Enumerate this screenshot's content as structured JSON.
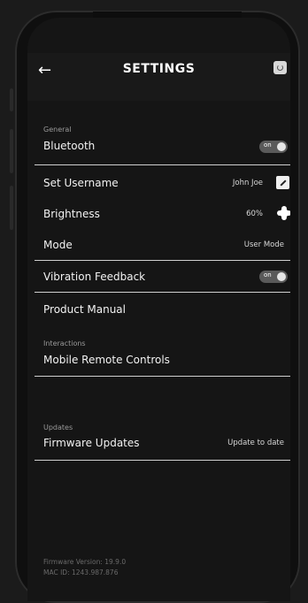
{
  "header": {
    "title": "SETTINGS"
  },
  "general": {
    "section": "General",
    "bluetooth": "Bluetooth",
    "bluetooth_state": "on"
  },
  "rows": {
    "username_label": "Set Username",
    "username_value": "John Joe",
    "brightness_label": "Brightness",
    "brightness_value": "60%",
    "mode_label": "Mode",
    "mode_value": "User Mode",
    "vibration_label": "Vibration Feedback",
    "vibration_state": "on",
    "manual_label": "Product Manual"
  },
  "interactions": {
    "section": "Interactions",
    "remote_label": "Mobile Remote Controls"
  },
  "updates": {
    "section": "Updates",
    "firmware_label": "Firmware Updates",
    "firmware_value": "Update to date"
  },
  "footer": {
    "firmware_version": "Firmware Version: 19.9.0",
    "mac_id": "MAC ID: 1243.987.876"
  },
  "icons": {
    "back": "arrow-left-icon",
    "power": "power-icon",
    "edit": "pencil-icon",
    "brightness": "brightness-icon"
  }
}
